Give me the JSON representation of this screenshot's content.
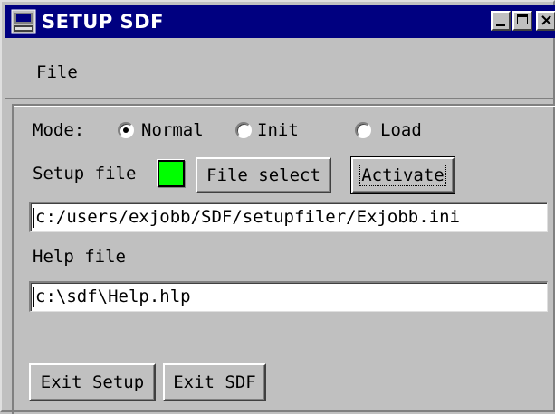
{
  "window": {
    "title": "SETUP SDF",
    "controls": {
      "minimize": "_",
      "maximize": "□",
      "close": "×"
    }
  },
  "menu": {
    "file": "File"
  },
  "mode": {
    "label": "Mode:",
    "options": [
      {
        "label": "Normal",
        "selected": true
      },
      {
        "label": "Init",
        "selected": false
      },
      {
        "label": "Load",
        "selected": false
      }
    ]
  },
  "setup": {
    "label": "Setup file",
    "status_color": "#00ff00",
    "file_select_label": "File select",
    "activate_label": "Activate",
    "path_value": "c:/users/exjobb/SDF/setupfiler/Exjobb.ini"
  },
  "help": {
    "label": "Help file",
    "path_value": "c:\\sdf\\Help.hlp"
  },
  "footer": {
    "exit_setup_label": "Exit Setup",
    "exit_sdf_label": "Exit SDF"
  }
}
